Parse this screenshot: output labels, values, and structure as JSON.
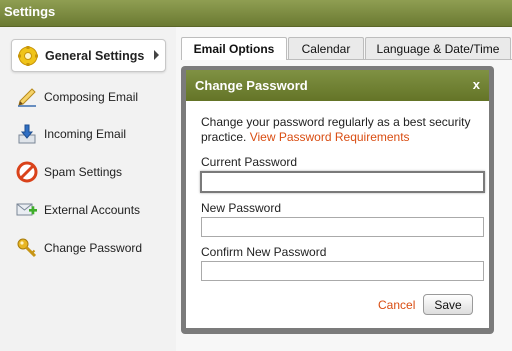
{
  "header": {
    "title": "Settings"
  },
  "sidebar": {
    "items": [
      {
        "label": "General Settings",
        "icon": "gear-icon"
      },
      {
        "label": "Composing Email",
        "icon": "pencil-icon"
      },
      {
        "label": "Incoming Email",
        "icon": "inbox-download-icon"
      },
      {
        "label": "Spam Settings",
        "icon": "no-entry-icon"
      },
      {
        "label": "External Accounts",
        "icon": "add-account-icon"
      },
      {
        "label": "Change Password",
        "icon": "key-icon"
      }
    ]
  },
  "tabs": [
    {
      "label": "Email Options"
    },
    {
      "label": "Calendar"
    },
    {
      "label": "Language & Date/Time"
    }
  ],
  "modal": {
    "title": "Change Password",
    "close": "x",
    "description": "Change your password regularly as a best security practice.",
    "requirements_link": "View Password Requirements",
    "current_label": "Current Password",
    "current_value": "",
    "new_label": "New Password",
    "new_value": "",
    "confirm_label": "Confirm New Password",
    "confirm_value": "",
    "cancel_label": "Cancel",
    "save_label": "Save"
  },
  "colors": {
    "header_green": "#6b7a32",
    "link_orange": "#d94d12"
  }
}
